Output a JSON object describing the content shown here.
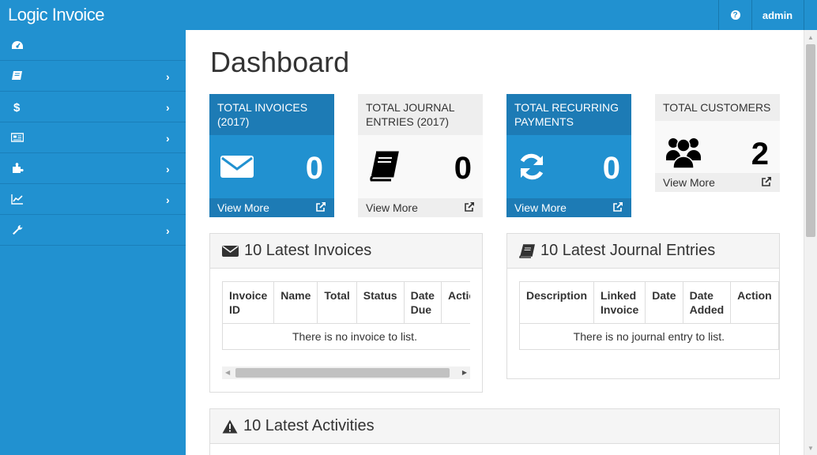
{
  "app": {
    "logo": "LogicInvoice",
    "logo_l1": "L",
    "logo_rest": "ogic Invoice"
  },
  "topbar": {
    "help_icon": "question-circle-icon",
    "user_label": "admin"
  },
  "sidebar": {
    "items": [
      {
        "icon": "dashboard-icon",
        "has_chevron": false
      },
      {
        "icon": "book-icon",
        "has_chevron": true,
        "chevron": "›"
      },
      {
        "icon": "dollar-icon",
        "has_chevron": true,
        "chevron": "›"
      },
      {
        "icon": "newspaper-icon",
        "has_chevron": true,
        "chevron": "›"
      },
      {
        "icon": "puzzle-icon",
        "has_chevron": true,
        "chevron": "›"
      },
      {
        "icon": "line-chart-icon",
        "has_chevron": true,
        "chevron": "›"
      },
      {
        "icon": "wrench-icon",
        "has_chevron": true,
        "chevron": "›"
      }
    ]
  },
  "page": {
    "title": "Dashboard"
  },
  "stats": [
    {
      "title": "TOTAL INVOICES (2017)",
      "value": "0",
      "link": "View More",
      "icon": "envelope-icon",
      "color": "#2191d0"
    },
    {
      "title": "TOTAL JOURNAL ENTRIES (2017)",
      "value": "0",
      "link": "View More",
      "icon": "book-icon",
      "color": "#eeeeee"
    },
    {
      "title": "TOTAL RECURRING PAYMENTS",
      "value": "0",
      "link": "View More",
      "icon": "refresh-icon",
      "color": "#2191d0"
    },
    {
      "title": "TOTAL CUSTOMERS",
      "value": "2",
      "link": "View More",
      "icon": "users-icon",
      "color": "#eeeeee"
    }
  ],
  "invoices_panel": {
    "title": "10 Latest Invoices",
    "columns": [
      "Invoice ID",
      "Name",
      "Total",
      "Status",
      "Date Due",
      "Action"
    ],
    "empty": "There is no invoice to list."
  },
  "journal_panel": {
    "title": "10 Latest Journal Entries",
    "columns": [
      "Description",
      "Linked Invoice",
      "Date",
      "Date Added",
      "Action"
    ],
    "empty": "There is no journal entry to list."
  },
  "activities_panel": {
    "title": "10 Latest Activities"
  }
}
